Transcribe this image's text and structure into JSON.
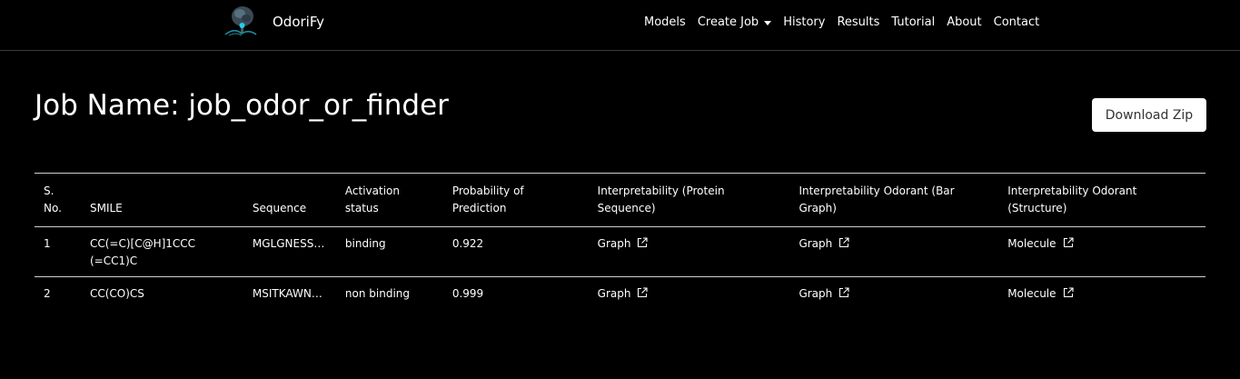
{
  "brand": {
    "name": "OdoriFy",
    "logo_icon": "tree-brain-logo-icon"
  },
  "nav": {
    "items": [
      {
        "label": "Models"
      },
      {
        "label": "Create Job",
        "dropdown": true
      },
      {
        "label": "History"
      },
      {
        "label": "Results"
      },
      {
        "label": "Tutorial"
      },
      {
        "label": "About"
      },
      {
        "label": "Contact"
      }
    ]
  },
  "page": {
    "title": "Job Name: job_odor_or_finder",
    "download_label": "Download Zip"
  },
  "table": {
    "headers": [
      "S. No.",
      "SMILE",
      "Sequence",
      "Activation status",
      "Probability of Prediction",
      "Interpretability (Protein Sequence)",
      "Interpretability Odorant (Bar Graph)",
      "Interpretability Odorant (Structure)"
    ],
    "rows": [
      {
        "sno": "1",
        "smile": "CC(=C)[C@H]1CCC(=CC1)C",
        "sequence": "MGLGNESSL...",
        "status": "binding",
        "probability": "0.922",
        "protein_link": "Graph",
        "bar_link": "Graph",
        "structure_link": "Molecule"
      },
      {
        "sno": "2",
        "smile": "CC(CO)CS",
        "sequence": "MSITKAWNS...",
        "status": "non binding",
        "probability": "0.999",
        "protein_link": "Graph",
        "bar_link": "Graph",
        "structure_link": "Molecule"
      }
    ]
  },
  "colors": {
    "background": "#000000",
    "text": "#ffffff",
    "divider": "#d0d0d0",
    "button_bg": "#ffffff"
  }
}
